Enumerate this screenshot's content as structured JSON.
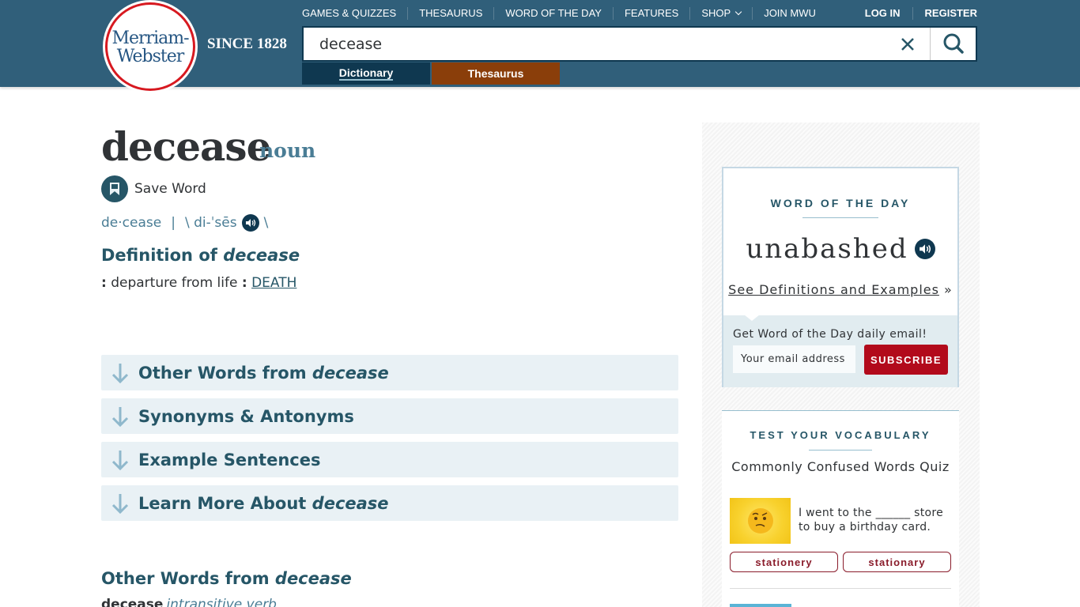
{
  "header": {
    "logo_line1": "Merriam-",
    "logo_line2": "Webster",
    "since": "SINCE 1828",
    "nav": [
      "GAMES & QUIZZES",
      "THESAURUS",
      "WORD OF THE DAY",
      "FEATURES",
      "SHOP",
      "JOIN MWU"
    ],
    "auth": [
      "LOG IN",
      "REGISTER"
    ],
    "search": {
      "value": "decease",
      "placeholder": ""
    },
    "tabs": {
      "dictionary": "Dictionary",
      "thesaurus": "Thesaurus"
    }
  },
  "entry": {
    "headword": "decease",
    "part_of_speech": "noun",
    "save_label": "Save Word",
    "syllables": "de·cease",
    "separator": "|",
    "pron_open": "\\ di-ˈsēs",
    "pron_close": "\\",
    "definition_title_prefix": "Definition of ",
    "definition_title_word": "decease",
    "definition_colon": ":",
    "definition_text": " departure from life ",
    "definition_colon2": ":",
    "definition_link": "DEATH"
  },
  "sections": [
    {
      "label": "Other Words from ",
      "italic": "decease"
    },
    {
      "label": "Synonyms & Antonyms",
      "italic": ""
    },
    {
      "label": "Example Sentences",
      "italic": ""
    },
    {
      "label": "Learn More About ",
      "italic": "decease"
    }
  ],
  "other_words": {
    "title_prefix": "Other Words from ",
    "title_word": "decease",
    "word": "decease",
    "pos": "intransitive verb"
  },
  "sidebar": {
    "wod": {
      "heading": "WORD OF THE DAY",
      "word": "unabashed",
      "link": "See Definitions and Examples",
      "link_suffix": " »",
      "email_label": "Get Word of the Day daily email!",
      "email_placeholder": "Your email address",
      "subscribe": "SUBSCRIBE"
    },
    "vocab": {
      "heading": "TEST YOUR VOCABULARY",
      "quiz_title": "Commonly Confused Words Quiz",
      "question": "I went to the ______ store to buy a birthday card.",
      "options": [
        "stationery",
        "stationary"
      ]
    }
  },
  "colors": {
    "header_bg": "#305f7a",
    "dictionary_tab": "#0f3850",
    "thesaurus_tab": "#8a3e0a",
    "accent": "#265667",
    "subscribe": "#b20a1b"
  }
}
